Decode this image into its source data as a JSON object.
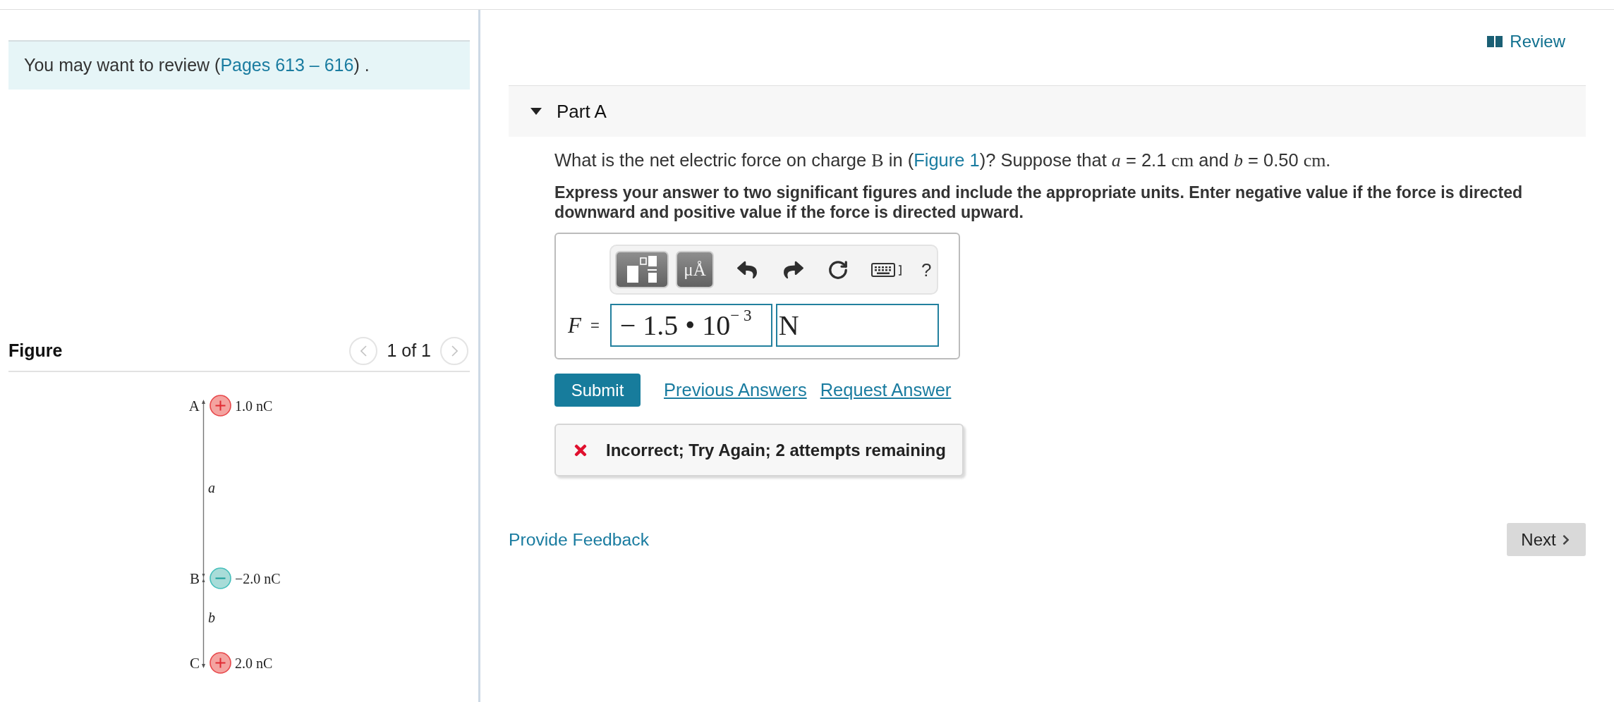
{
  "review_note": {
    "text": "You may want to review (",
    "link": "Pages 613 – 616",
    "text_end": ") ."
  },
  "figure_panel": {
    "title": "Figure",
    "previous": {
      "disabled": true
    },
    "counter": "1 of 1",
    "next": {
      "disabled": true
    },
    "charges": [
      {
        "label": "A",
        "kind": "positive",
        "value": "1.0 nC"
      },
      {
        "label": "B",
        "kind": "negative",
        "value": "−2.0 nC"
      },
      {
        "label": "C",
        "kind": "positive",
        "value": "2.0 nC"
      }
    ],
    "distances": [
      "a",
      "b"
    ]
  },
  "review_link": "Review",
  "part": {
    "title": "Part A",
    "expanded": true,
    "question": [
      {
        "kind": "text",
        "text": "What is the net electric force on charge "
      },
      {
        "kind": "math",
        "text": "B"
      },
      {
        "kind": "text",
        "text": " in ("
      },
      {
        "kind": "link",
        "text": "Figure 1"
      },
      {
        "kind": "text",
        "text": ")? Suppose that "
      },
      {
        "kind": "var",
        "text": "a"
      },
      {
        "kind": "text",
        "text": " = 2.1 "
      },
      {
        "kind": "math",
        "text": "cm"
      },
      {
        "kind": "text",
        "text": " and "
      },
      {
        "kind": "var",
        "text": "b"
      },
      {
        "kind": "text",
        "text": " = 0.50 "
      },
      {
        "kind": "math",
        "text": "cm"
      },
      {
        "kind": "math",
        "text": "."
      }
    ],
    "instructions": "Express your answer to two significant figures and include the appropriate units. Enter negative value if the force is directed downward and positive value if the force is directed upward.",
    "toolbar": [
      {
        "kind": "templates"
      },
      {
        "kind": "symbols",
        "label": "μÅ"
      },
      {
        "kind": "undo"
      },
      {
        "kind": "redo"
      },
      {
        "kind": "reset"
      },
      {
        "kind": "keyboard"
      },
      {
        "kind": "help",
        "label": "?"
      }
    ],
    "answer": {
      "variable": "F",
      "equals": "=",
      "value": "− 1.5 • 10$^{− 3}$",
      "unit": "N"
    },
    "submit": "Submit",
    "links": [
      "Previous Answers",
      "Request Answer"
    ],
    "feedback": {
      "kind": "incorrect",
      "text": "Incorrect; Try Again; 2 attempts remaining"
    }
  },
  "footer": {
    "feedback_link": "Provide Feedback",
    "next": "Next"
  }
}
